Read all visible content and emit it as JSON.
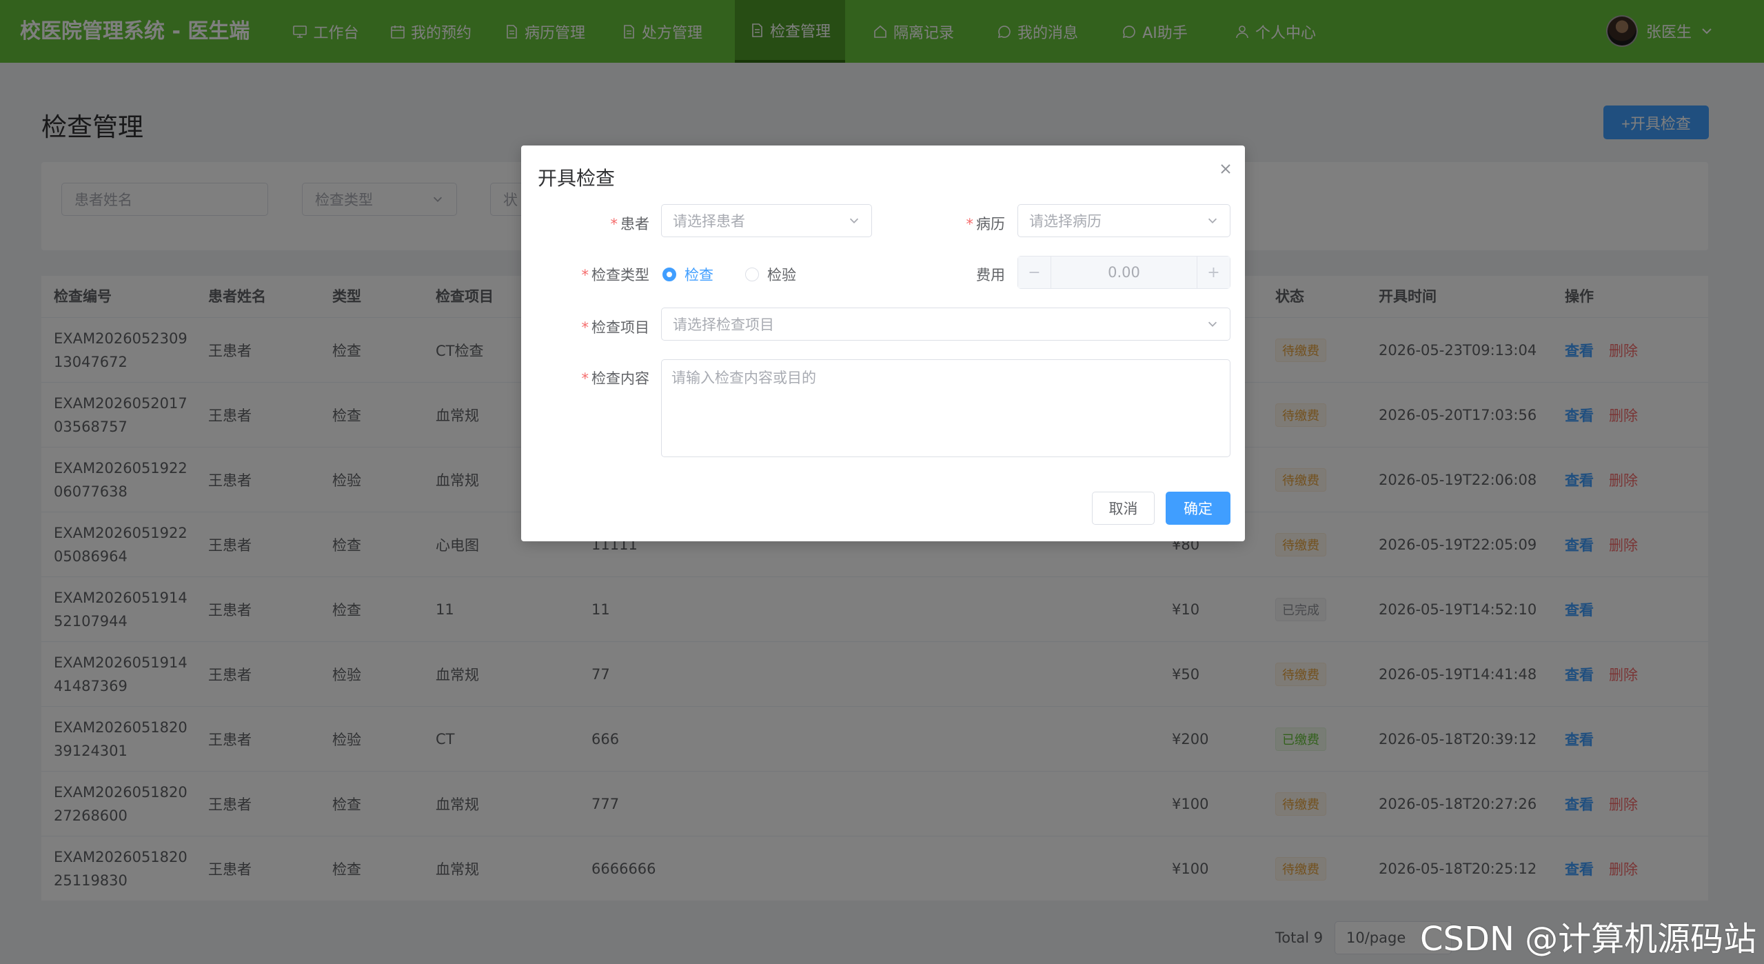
{
  "header": {
    "brand": "校医院管理系统 - 医生端",
    "nav": [
      {
        "label": "工作台",
        "icon": "monitor-icon"
      },
      {
        "label": "我的预约",
        "icon": "calendar-icon"
      },
      {
        "label": "病历管理",
        "icon": "document-icon"
      },
      {
        "label": "处方管理",
        "icon": "document-icon"
      },
      {
        "label": "检查管理",
        "icon": "document-icon",
        "active": true
      },
      {
        "label": "隔离记录",
        "icon": "house-icon"
      },
      {
        "label": "我的消息",
        "icon": "chat-icon"
      },
      {
        "label": "AI助手",
        "icon": "chat-icon"
      },
      {
        "label": "个人中心",
        "icon": "user-icon"
      }
    ],
    "user_name": "张医生"
  },
  "page": {
    "title": "检查管理",
    "add_button": "+开具检查"
  },
  "filters": {
    "patient_placeholder": "患者姓名",
    "type_placeholder": "检查类型",
    "status_placeholder": "状"
  },
  "table": {
    "headers": [
      "检查编号",
      "患者姓名",
      "类型",
      "检查项目",
      "状态",
      "开具时间",
      "操作"
    ],
    "view_label": "查看",
    "delete_label": "删除",
    "rows": [
      {
        "id": "EXAM202605230913047672",
        "patient": "王患者",
        "type": "检查",
        "item": "CT检查",
        "content": "",
        "fee": "",
        "status": "待缴费",
        "status_kind": "pending",
        "time": "2026-05-23T09:13:04",
        "deletable": true
      },
      {
        "id": "EXAM202605201703568757",
        "patient": "王患者",
        "type": "检查",
        "item": "血常规",
        "content": "",
        "fee": "",
        "status": "待缴费",
        "status_kind": "pending",
        "time": "2026-05-20T17:03:56",
        "deletable": true
      },
      {
        "id": "EXAM202605192206077638",
        "patient": "王患者",
        "type": "检验",
        "item": "血常规",
        "content": "",
        "fee": "",
        "status": "待缴费",
        "status_kind": "pending",
        "time": "2026-05-19T22:06:08",
        "deletable": true
      },
      {
        "id": "EXAM202605192205086964",
        "patient": "王患者",
        "type": "检查",
        "item": "心电图",
        "content": "11111",
        "fee": "¥80",
        "status": "待缴费",
        "status_kind": "pending",
        "time": "2026-05-19T22:05:09",
        "deletable": true
      },
      {
        "id": "EXAM202605191452107944",
        "patient": "王患者",
        "type": "检查",
        "item": "11",
        "content": "11",
        "fee": "¥10",
        "status": "已完成",
        "status_kind": "done",
        "time": "2026-05-19T14:52:10",
        "deletable": false
      },
      {
        "id": "EXAM202605191441487369",
        "patient": "王患者",
        "type": "检验",
        "item": "血常规",
        "content": "77",
        "fee": "¥50",
        "status": "待缴费",
        "status_kind": "pending",
        "time": "2026-05-19T14:41:48",
        "deletable": true
      },
      {
        "id": "EXAM202605182039124301",
        "patient": "王患者",
        "type": "检验",
        "item": "CT",
        "content": "666",
        "fee": "¥200",
        "status": "已缴费",
        "status_kind": "paid",
        "time": "2026-05-18T20:39:12",
        "deletable": false
      },
      {
        "id": "EXAM202605182027268600",
        "patient": "王患者",
        "type": "检查",
        "item": "血常规",
        "content": "777",
        "fee": "¥100",
        "status": "待缴费",
        "status_kind": "pending",
        "time": "2026-05-18T20:27:26",
        "deletable": true
      },
      {
        "id": "EXAM202605182025119830",
        "patient": "王患者",
        "type": "检查",
        "item": "血常规",
        "content": "6666666",
        "fee": "¥100",
        "status": "待缴费",
        "status_kind": "pending",
        "time": "2026-05-18T20:25:12",
        "deletable": true
      }
    ]
  },
  "pagination": {
    "total": "Total 9",
    "page_size": "10/page"
  },
  "dialog": {
    "title": "开具检查",
    "patient_label": "患者",
    "patient_placeholder": "请选择患者",
    "record_label": "病历",
    "record_placeholder": "请选择病历",
    "type_label": "检查类型",
    "type_options": [
      "检查",
      "检验"
    ],
    "type_selected": "检查",
    "fee_label": "费用",
    "fee_value": "0.00",
    "item_label": "检查项目",
    "item_placeholder": "请选择检查项目",
    "content_label": "检查内容",
    "content_placeholder": "请输入检查内容或目的",
    "cancel": "取消",
    "confirm": "确定"
  },
  "watermark": "CSDN @计算机源码站",
  "colors": {
    "header": "#67c23a",
    "primary": "#409eff",
    "danger": "#f56c6c",
    "warning": "#e6a23c"
  }
}
